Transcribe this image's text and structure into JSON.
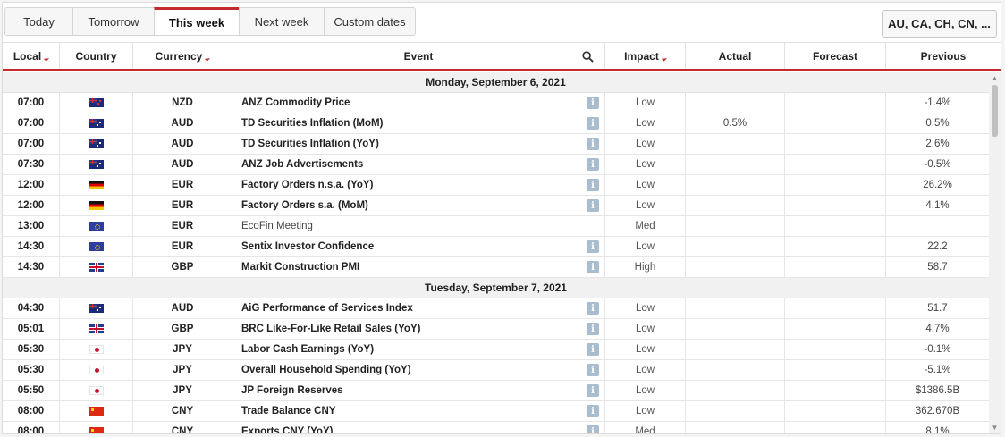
{
  "tabs": [
    "Today",
    "Tomorrow",
    "This week",
    "Next week",
    "Custom dates"
  ],
  "country_filter": "AU, CA, CH, CN, ...",
  "columns": {
    "local": "Local",
    "country": "Country",
    "currency": "Currency",
    "event": "Event",
    "impact": "Impact",
    "actual": "Actual",
    "forecast": "Forecast",
    "previous": "Previous"
  },
  "days": [
    {
      "label": "Monday, September 6, 2021",
      "rows": [
        {
          "time": "07:00",
          "flag": "nz",
          "currency": "NZD",
          "event": "ANZ Commodity Price",
          "info": true,
          "impact": "Low",
          "actual": "",
          "forecast": "",
          "previous": "-1.4%"
        },
        {
          "time": "07:00",
          "flag": "au",
          "currency": "AUD",
          "event": "TD Securities Inflation (MoM)",
          "info": true,
          "impact": "Low",
          "actual": "0.5%",
          "forecast": "",
          "previous": "0.5%"
        },
        {
          "time": "07:00",
          "flag": "au",
          "currency": "AUD",
          "event": "TD Securities Inflation (YoY)",
          "info": true,
          "impact": "Low",
          "actual": "",
          "forecast": "",
          "previous": "2.6%"
        },
        {
          "time": "07:30",
          "flag": "au",
          "currency": "AUD",
          "event": "ANZ Job Advertisements",
          "info": true,
          "impact": "Low",
          "actual": "",
          "forecast": "",
          "previous": "-0.5%"
        },
        {
          "time": "12:00",
          "flag": "de",
          "currency": "EUR",
          "event": "Factory Orders n.s.a. (YoY)",
          "info": true,
          "impact": "Low",
          "actual": "",
          "forecast": "",
          "previous": "26.2%"
        },
        {
          "time": "12:00",
          "flag": "de",
          "currency": "EUR",
          "event": "Factory Orders s.a. (MoM)",
          "info": true,
          "impact": "Low",
          "actual": "",
          "forecast": "",
          "previous": "4.1%"
        },
        {
          "time": "13:00",
          "flag": "eu",
          "currency": "EUR",
          "event": "EcoFin Meeting",
          "info": false,
          "plain": true,
          "impact": "Med",
          "actual": "",
          "forecast": "",
          "previous": ""
        },
        {
          "time": "14:30",
          "flag": "eu",
          "currency": "EUR",
          "event": "Sentix Investor Confidence",
          "info": true,
          "impact": "Low",
          "actual": "",
          "forecast": "",
          "previous": "22.2"
        },
        {
          "time": "14:30",
          "flag": "gb",
          "currency": "GBP",
          "event": "Markit Construction PMI",
          "info": true,
          "impact": "High",
          "actual": "",
          "forecast": "",
          "previous": "58.7"
        }
      ]
    },
    {
      "label": "Tuesday, September 7, 2021",
      "rows": [
        {
          "time": "04:30",
          "flag": "au",
          "currency": "AUD",
          "event": "AiG Performance of Services Index",
          "info": true,
          "impact": "Low",
          "actual": "",
          "forecast": "",
          "previous": "51.7"
        },
        {
          "time": "05:01",
          "flag": "gb",
          "currency": "GBP",
          "event": "BRC Like-For-Like Retail Sales (YoY)",
          "info": true,
          "impact": "Low",
          "actual": "",
          "forecast": "",
          "previous": "4.7%"
        },
        {
          "time": "05:30",
          "flag": "jp",
          "currency": "JPY",
          "event": "Labor Cash Earnings (YoY)",
          "info": true,
          "impact": "Low",
          "actual": "",
          "forecast": "",
          "previous": "-0.1%"
        },
        {
          "time": "05:30",
          "flag": "jp",
          "currency": "JPY",
          "event": "Overall Household Spending (YoY)",
          "info": true,
          "impact": "Low",
          "actual": "",
          "forecast": "",
          "previous": "-5.1%"
        },
        {
          "time": "05:50",
          "flag": "jp",
          "currency": "JPY",
          "event": "JP Foreign Reserves",
          "info": true,
          "impact": "Low",
          "actual": "",
          "forecast": "",
          "previous": "$1386.5B"
        },
        {
          "time": "08:00",
          "flag": "cn",
          "currency": "CNY",
          "event": "Trade Balance CNY",
          "info": true,
          "impact": "Low",
          "actual": "",
          "forecast": "",
          "previous": "362.670B"
        },
        {
          "time": "08:00",
          "flag": "cn",
          "currency": "CNY",
          "event": "Exports CNY (YoY)",
          "info": true,
          "impact": "Med",
          "actual": "",
          "forecast": "",
          "previous": "8.1%"
        }
      ]
    }
  ],
  "icons": {
    "search": "search-icon",
    "info": "info-icon",
    "sort": "sort-arrow-icon"
  },
  "colors": {
    "accent": "#c52b2b",
    "day_bg": "#f1f1f1",
    "info_bg": "#a9bdd1"
  }
}
